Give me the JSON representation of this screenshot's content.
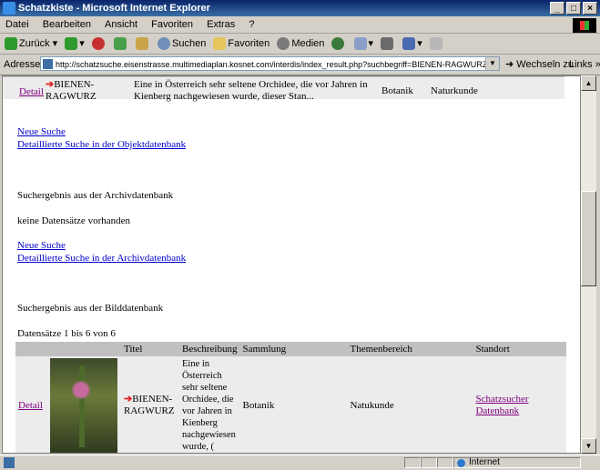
{
  "window": {
    "title": "Schatzkiste - Microsoft Internet Explorer",
    "min": "_",
    "max": "□",
    "close": "×"
  },
  "menu": [
    "Datei",
    "Bearbeiten",
    "Ansicht",
    "Favoriten",
    "Extras",
    "?"
  ],
  "toolbar": {
    "back": "Zurück",
    "search": "Suchen",
    "favorites": "Favoriten",
    "media": "Medien"
  },
  "address": {
    "label": "Adresse",
    "url": "http://schatzsuche.eisenstrasse.multimediaplan.kosnet.com/interdis/index_result.php?suchbegriff=BIENEN-RAGWURZ+&Submit=Su",
    "go": "Wechseln zu",
    "links": "Links »"
  },
  "top_row": {
    "detail": "Detail",
    "title_line1": "BIENEN-",
    "title_line2": "RAGWURZ",
    "desc_line1": "Eine in Österreich sehr seltene Orchidee, die vor Jahren in",
    "desc_line2": "Kienberg nachgewiesen wurde, dieser Stan...",
    "sammlung": "Botanik",
    "thema": "Naturkunde"
  },
  "objekt": {
    "new_search": "Neue Suche",
    "detail_search": "Detaillierte Suche in der Objektdatenbank"
  },
  "archiv": {
    "heading": "Suchergebnis aus der Archivdatenbank",
    "empty": "keine Datensätze vorhanden",
    "new_search": "Neue Suche",
    "detail_search": "Detaillierte Suche in der Archivdatenbank"
  },
  "bild": {
    "heading": "Suchergebnis aus der Bilddatenbank",
    "count": "Datensätze 1 bis 6 von 6",
    "headers": [
      "Titel",
      "Beschreibung",
      "Sammlung",
      "Themenbereich",
      "Standort"
    ],
    "row": {
      "detail": "Detail",
      "title_line1": "BIENEN-",
      "title_line2": "RAGWURZ",
      "desc": [
        "Eine in",
        "Österreich",
        "sehr seltene",
        "Orchidee, die",
        "vor Jahren in",
        "Kienberg",
        "nachgewiesen",
        "wurde, ("
      ],
      "sammlung": "Botanik",
      "thema": "Natukunde",
      "standort_line1": "Schatzsucher",
      "standort_line2": "Datenbank"
    }
  },
  "status": {
    "zone": "Internet"
  }
}
